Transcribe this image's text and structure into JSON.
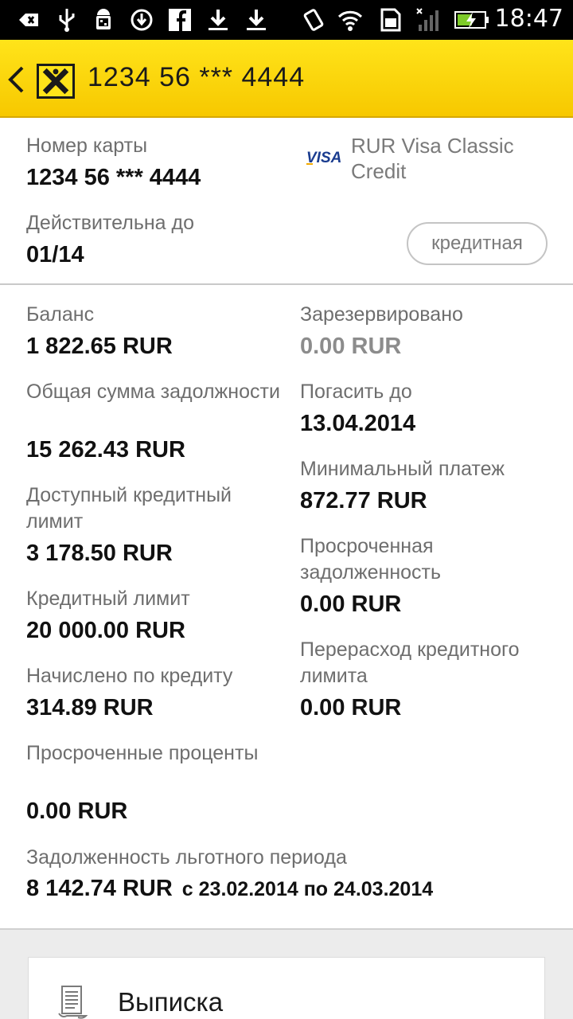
{
  "status_bar": {
    "time": "18:47",
    "icons": [
      "back-notification-icon",
      "usb-icon",
      "android-debug-icon",
      "sync-icon",
      "facebook-icon",
      "download-icon",
      "download-icon",
      "rotate-icon",
      "wifi-icon",
      "sim-icon",
      "signal-icon",
      "battery-charging-icon"
    ]
  },
  "app_bar": {
    "title": "1234 56 *** 4444"
  },
  "card": {
    "number_label": "Номер карты",
    "number_value": "1234 56 *** 4444",
    "valid_label": "Действительна до",
    "valid_value": "01/14",
    "brand": "VISA",
    "type_label": "RUR Visa Classic Credit",
    "chip_label": "кредитная"
  },
  "left_fields": [
    {
      "label": "Баланс",
      "value": "1 822.65 RUR"
    },
    {
      "label": "Общая сумма задолжности",
      "value": "15 262.43 RUR"
    },
    {
      "label": "Доступный кредитный лимит",
      "value": "3 178.50 RUR"
    },
    {
      "label": "Кредитный лимит",
      "value": "20 000.00 RUR"
    },
    {
      "label": "Начислено по кредиту",
      "value": "314.89 RUR"
    },
    {
      "label": "Просроченные проценты",
      "value": "0.00 RUR"
    }
  ],
  "right_fields": [
    {
      "label": "Зарезервировано",
      "value": "0.00 RUR"
    },
    {
      "label": "Погасить до",
      "value": "13.04.2014"
    },
    {
      "label": "Минимальный платеж",
      "value": "872.77 RUR"
    },
    {
      "label": "Просроченная задолженность",
      "value": "0.00 RUR"
    },
    {
      "label": "Перерасход кредитного лимита",
      "value": "0.00 RUR"
    }
  ],
  "grace": {
    "label": "Задолженность льготного периода",
    "value": "8 142.74 RUR",
    "period": "с 23.02.2014 по 24.03.2014"
  },
  "statement": {
    "label": "Выписка"
  },
  "colors": {
    "accent_yellow": "#ffe41a",
    "label_grey": "#6e6e6e",
    "visa_blue": "#1a3c8f",
    "visa_gold": "#f2a900"
  }
}
